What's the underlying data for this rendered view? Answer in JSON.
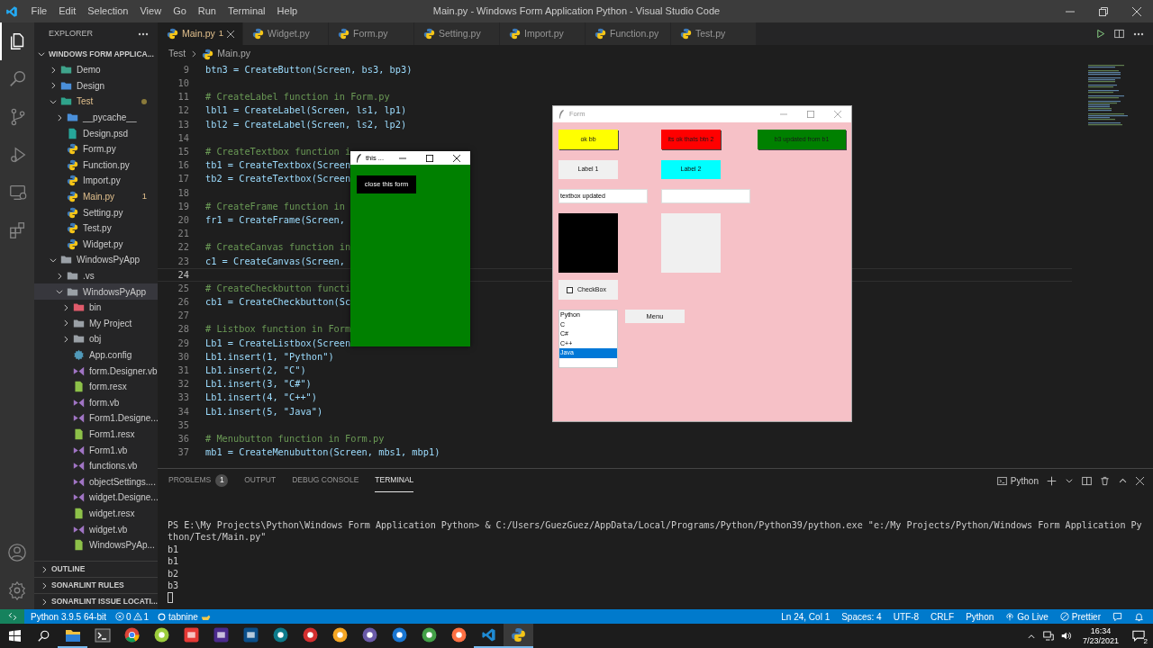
{
  "title_bar": {
    "menu": [
      "File",
      "Edit",
      "Selection",
      "View",
      "Go",
      "Run",
      "Terminal",
      "Help"
    ],
    "title": "Main.py - Windows Form Application Python - Visual Studio Code"
  },
  "activity_bar": {
    "items": [
      {
        "kind": "explorer",
        "selected": true
      },
      {
        "kind": "search",
        "selected": false
      },
      {
        "kind": "source_control",
        "selected": false
      },
      {
        "kind": "run",
        "selected": false
      },
      {
        "kind": "remote",
        "selected": false
      },
      {
        "kind": "extensions",
        "selected": false
      }
    ]
  },
  "sidebar": {
    "title": "EXPLORER",
    "root": "WINDOWS FORM APPLICA...",
    "tree": [
      {
        "label": "Demo",
        "kind": "folder",
        "color": "#3fa38b",
        "expanded": false,
        "selected": false,
        "modified": false
      },
      {
        "label": "Design",
        "kind": "folder",
        "color": "#4a8fd9",
        "expanded": false,
        "selected": false,
        "modified": false
      },
      {
        "label": "Test",
        "kind": "folder",
        "color": "#2fa38b",
        "expanded": true,
        "selected": false,
        "modified": true,
        "children": [
          {
            "label": "__pycache__",
            "kind": "folder",
            "color": "#4a8fd9",
            "expanded": false,
            "selected": false,
            "modified": false
          },
          {
            "label": "Design.psd",
            "kind": "psd",
            "selected": false,
            "modified": false
          },
          {
            "label": "Form.py",
            "kind": "python",
            "selected": false,
            "modified": false
          },
          {
            "label": "Function.py",
            "kind": "python",
            "selected": false,
            "modified": false
          },
          {
            "label": "Import.py",
            "kind": "python",
            "selected": false,
            "modified": false
          },
          {
            "label": "Main.py",
            "kind": "python",
            "selected": false,
            "modified": true,
            "badge": "1"
          },
          {
            "label": "Setting.py",
            "kind": "python",
            "selected": false,
            "modified": false
          },
          {
            "label": "Test.py",
            "kind": "python",
            "selected": false,
            "modified": false
          },
          {
            "label": "Widget.py",
            "kind": "python",
            "selected": false,
            "modified": false
          }
        ]
      },
      {
        "label": "WindowsPyApp",
        "kind": "folder",
        "color": "#9aa0a6",
        "expanded": true,
        "selected": false,
        "modified": false,
        "children": [
          {
            "label": ".vs",
            "kind": "folder",
            "color": "#9aa0a6",
            "expanded": false,
            "selected": false,
            "modified": false
          },
          {
            "label": "WindowsPyApp",
            "kind": "folder",
            "color": "#9aa0a6",
            "expanded": true,
            "selected": true,
            "modified": false,
            "children": [
              {
                "label": "bin",
                "kind": "folder",
                "color": "#e05b6b",
                "expanded": false,
                "selected": false,
                "modified": false
              },
              {
                "label": "My Project",
                "kind": "folder",
                "color": "#9aa0a6",
                "expanded": false,
                "selected": false,
                "modified": false
              },
              {
                "label": "obj",
                "kind": "folder",
                "color": "#9aa0a6",
                "expanded": false,
                "selected": false,
                "modified": false
              },
              {
                "label": "App.config",
                "kind": "config",
                "selected": false,
                "modified": false
              },
              {
                "label": "form.Designer.vb",
                "kind": "vb",
                "selected": false,
                "modified": false
              },
              {
                "label": "form.resx",
                "kind": "resx",
                "selected": false,
                "modified": false
              },
              {
                "label": "form.vb",
                "kind": "vb",
                "selected": false,
                "modified": false
              },
              {
                "label": "Form1.Designe...",
                "kind": "vb",
                "selected": false,
                "modified": false
              },
              {
                "label": "Form1.resx",
                "kind": "resx",
                "selected": false,
                "modified": false
              },
              {
                "label": "Form1.vb",
                "kind": "vb",
                "selected": false,
                "modified": false
              },
              {
                "label": "functions.vb",
                "kind": "vb",
                "selected": false,
                "modified": false
              },
              {
                "label": "objectSettings....",
                "kind": "vb",
                "selected": false,
                "modified": false
              },
              {
                "label": "widget.Designe...",
                "kind": "vb",
                "selected": false,
                "modified": false
              },
              {
                "label": "widget.resx",
                "kind": "resx",
                "selected": false,
                "modified": false
              },
              {
                "label": "widget.vb",
                "kind": "vb",
                "selected": false,
                "modified": false
              },
              {
                "label": "WindowsPyAp...",
                "kind": "resx",
                "selected": false,
                "modified": false
              }
            ]
          }
        ]
      }
    ],
    "sections": [
      "OUTLINE",
      "SONARLINT RULES",
      "SONARLINT ISSUE LOCATI..."
    ]
  },
  "editor": {
    "tabs": [
      {
        "label": "Main.py",
        "selected": true,
        "modified": true,
        "badge": "1"
      },
      {
        "label": "Widget.py",
        "selected": false,
        "modified": false
      },
      {
        "label": "Form.py",
        "selected": false,
        "modified": false
      },
      {
        "label": "Setting.py",
        "selected": false,
        "modified": false
      },
      {
        "label": "Import.py",
        "selected": false,
        "modified": false
      },
      {
        "label": "Function.py",
        "selected": false,
        "modified": false
      },
      {
        "label": "Test.py",
        "selected": false,
        "modified": false
      }
    ],
    "breadcrumb": [
      "Test",
      "Main.py"
    ],
    "lines": [
      {
        "number": "9",
        "kind": "code",
        "text": "btn3 = CreateButton(Screen, bs3, bp3)",
        "current": false
      },
      {
        "number": "10",
        "kind": "blank",
        "current": false
      },
      {
        "number": "11",
        "kind": "comment",
        "text": "# CreateLabel function in Form.py",
        "current": false
      },
      {
        "number": "12",
        "kind": "code",
        "text": "lbl1 = CreateLabel(Screen, ls1, lp1)",
        "current": false
      },
      {
        "number": "13",
        "kind": "code",
        "text": "lbl2 = CreateLabel(Screen, ls2, lp2)",
        "current": false
      },
      {
        "number": "14",
        "kind": "blank",
        "current": false
      },
      {
        "number": "15",
        "kind": "comment",
        "text": "# CreateTextbox function i",
        "current": false
      },
      {
        "number": "16",
        "kind": "code",
        "text": "tb1 = CreateTextbox(Screen",
        "current": false
      },
      {
        "number": "17",
        "kind": "code",
        "text": "tb2 = CreateTextbox(Screen",
        "current": false
      },
      {
        "number": "18",
        "kind": "blank",
        "current": false
      },
      {
        "number": "19",
        "kind": "comment",
        "text": "# CreateFrame function in",
        "current": false
      },
      {
        "number": "20",
        "kind": "code",
        "text": "fr1 = CreateFrame(Screen,",
        "current": false
      },
      {
        "number": "21",
        "kind": "blank",
        "current": false
      },
      {
        "number": "22",
        "kind": "comment",
        "text": "# CreateCanvas function in",
        "current": false
      },
      {
        "number": "23",
        "kind": "code",
        "text": "c1 = CreateCanvas(Screen,",
        "current": false
      },
      {
        "number": "24",
        "kind": "blank",
        "current": true
      },
      {
        "number": "25",
        "kind": "comment",
        "text": "# CreateCheckbutton functi",
        "current": false
      },
      {
        "number": "26",
        "kind": "code",
        "text": "cb1 = CreateCheckbutton(Sc",
        "current": false
      },
      {
        "number": "27",
        "kind": "blank",
        "current": false
      },
      {
        "number": "28",
        "kind": "comment",
        "text": "# Listbox function in Form",
        "current": false
      },
      {
        "number": "29",
        "kind": "code",
        "text": "Lb1 = CreateListbox(Screen",
        "current": false
      },
      {
        "number": "30",
        "kind": "code",
        "text": "Lb1.insert(1, \"Python\")",
        "current": false
      },
      {
        "number": "31",
        "kind": "code",
        "text": "Lb1.insert(2, \"C\")",
        "current": false
      },
      {
        "number": "32",
        "kind": "code",
        "text": "Lb1.insert(3, \"C#\")",
        "current": false
      },
      {
        "number": "33",
        "kind": "code",
        "text": "Lb1.insert(4, \"C++\")",
        "current": false
      },
      {
        "number": "34",
        "kind": "code",
        "text": "Lb1.insert(5, \"Java\")",
        "current": false
      },
      {
        "number": "35",
        "kind": "blank",
        "current": false
      },
      {
        "number": "36",
        "kind": "comment",
        "text": "# Menubutton function in Form.py",
        "current": false
      },
      {
        "number": "37",
        "kind": "code",
        "text": "mb1 = CreateMenubutton(Screen, mbs1, mbp1)",
        "current": false
      }
    ]
  },
  "small_window": {
    "title": "this ...",
    "button": "close this form"
  },
  "form_window": {
    "title": "Form",
    "buttons": [
      {
        "label": "ok bb",
        "color": "#ffff00"
      },
      {
        "label": "its ok thats btn 2",
        "color": "#ff0000"
      },
      {
        "label": "b3 updated from b1",
        "color": "#008000"
      }
    ],
    "labels": [
      {
        "label": "Label 1",
        "color": "#f0f0f0"
      },
      {
        "label": "Label 2",
        "color": "#00ffff"
      }
    ],
    "textboxes": [
      {
        "kind": "filled",
        "value": "textbox updated"
      },
      {
        "kind": "empty"
      }
    ],
    "panels": [
      {
        "color": "#000000"
      },
      {
        "color": "#f0f0f0"
      }
    ],
    "checkbox": {
      "label": "CheckBox",
      "checked": false
    },
    "listbox": [
      {
        "label": "Python",
        "selected": false
      },
      {
        "label": "C",
        "selected": false
      },
      {
        "label": "C#",
        "selected": false
      },
      {
        "label": "C++",
        "selected": false
      },
      {
        "label": "Java",
        "selected": true
      }
    ],
    "menubutton": "Menu"
  },
  "panel": {
    "tabs": [
      {
        "label": "PROBLEMS",
        "selected": false,
        "badge": "1"
      },
      {
        "label": "OUTPUT",
        "selected": false
      },
      {
        "label": "DEBUG CONSOLE",
        "selected": false
      },
      {
        "label": "TERMINAL",
        "selected": true
      }
    ],
    "terminal_name": "Python",
    "lines": [
      "PS E:\\My Projects\\Python\\Windows Form Application Python> & C:/Users/GuezGuez/AppData/Local/Programs/Python/Python39/python.exe \"e:/My Projects/Python/Windows Form Application Py",
      "thon/Test/Main.py\"",
      "b1",
      "b1",
      "b2",
      "b3"
    ]
  },
  "status_bar": {
    "interpreter": "Python 3.9.5 64-bit",
    "errors": "0",
    "warnings": "1",
    "tabnine": "tabnine",
    "right": [
      "Ln 24, Col 1",
      "Spaces: 4",
      "UTF-8",
      "CRLF",
      "Python"
    ],
    "go_live": "Go Live",
    "prettier": "Prettier"
  },
  "taskbar": {
    "apps": [
      {
        "kind": "folder",
        "running": true,
        "selected": false
      },
      {
        "kind": "terminal",
        "running": false,
        "selected": false
      },
      {
        "kind": "chrome",
        "running": false,
        "selected": false
      },
      {
        "kind": "circle",
        "color": "#9ccc3c",
        "running": false,
        "selected": false
      },
      {
        "kind": "square",
        "color": "#e53935",
        "running": false,
        "selected": false
      },
      {
        "kind": "square",
        "color": "#4b2a8c",
        "running": false,
        "selected": false
      },
      {
        "kind": "square",
        "color": "#0b4f8a",
        "running": false,
        "selected": false
      },
      {
        "kind": "circle",
        "color": "#0d7a8a",
        "running": false,
        "selected": false
      },
      {
        "kind": "circle",
        "color": "#d32f2f",
        "running": false,
        "selected": false
      },
      {
        "kind": "circle",
        "color": "#f5a623",
        "running": false,
        "selected": false
      },
      {
        "kind": "circle",
        "color": "#6a5aa8",
        "running": false,
        "selected": false
      },
      {
        "kind": "circle",
        "color": "#1976d2",
        "running": false,
        "selected": false
      },
      {
        "kind": "circle",
        "color": "#43a047",
        "running": false,
        "selected": false
      },
      {
        "kind": "circle",
        "color": "#ff7043",
        "running": false,
        "selected": false
      },
      {
        "kind": "vscode",
        "running": true,
        "selected": false
      },
      {
        "kind": "python",
        "running": true,
        "selected": true
      }
    ],
    "time": "16:34",
    "date": "7/23/2021",
    "notifications": "2"
  }
}
